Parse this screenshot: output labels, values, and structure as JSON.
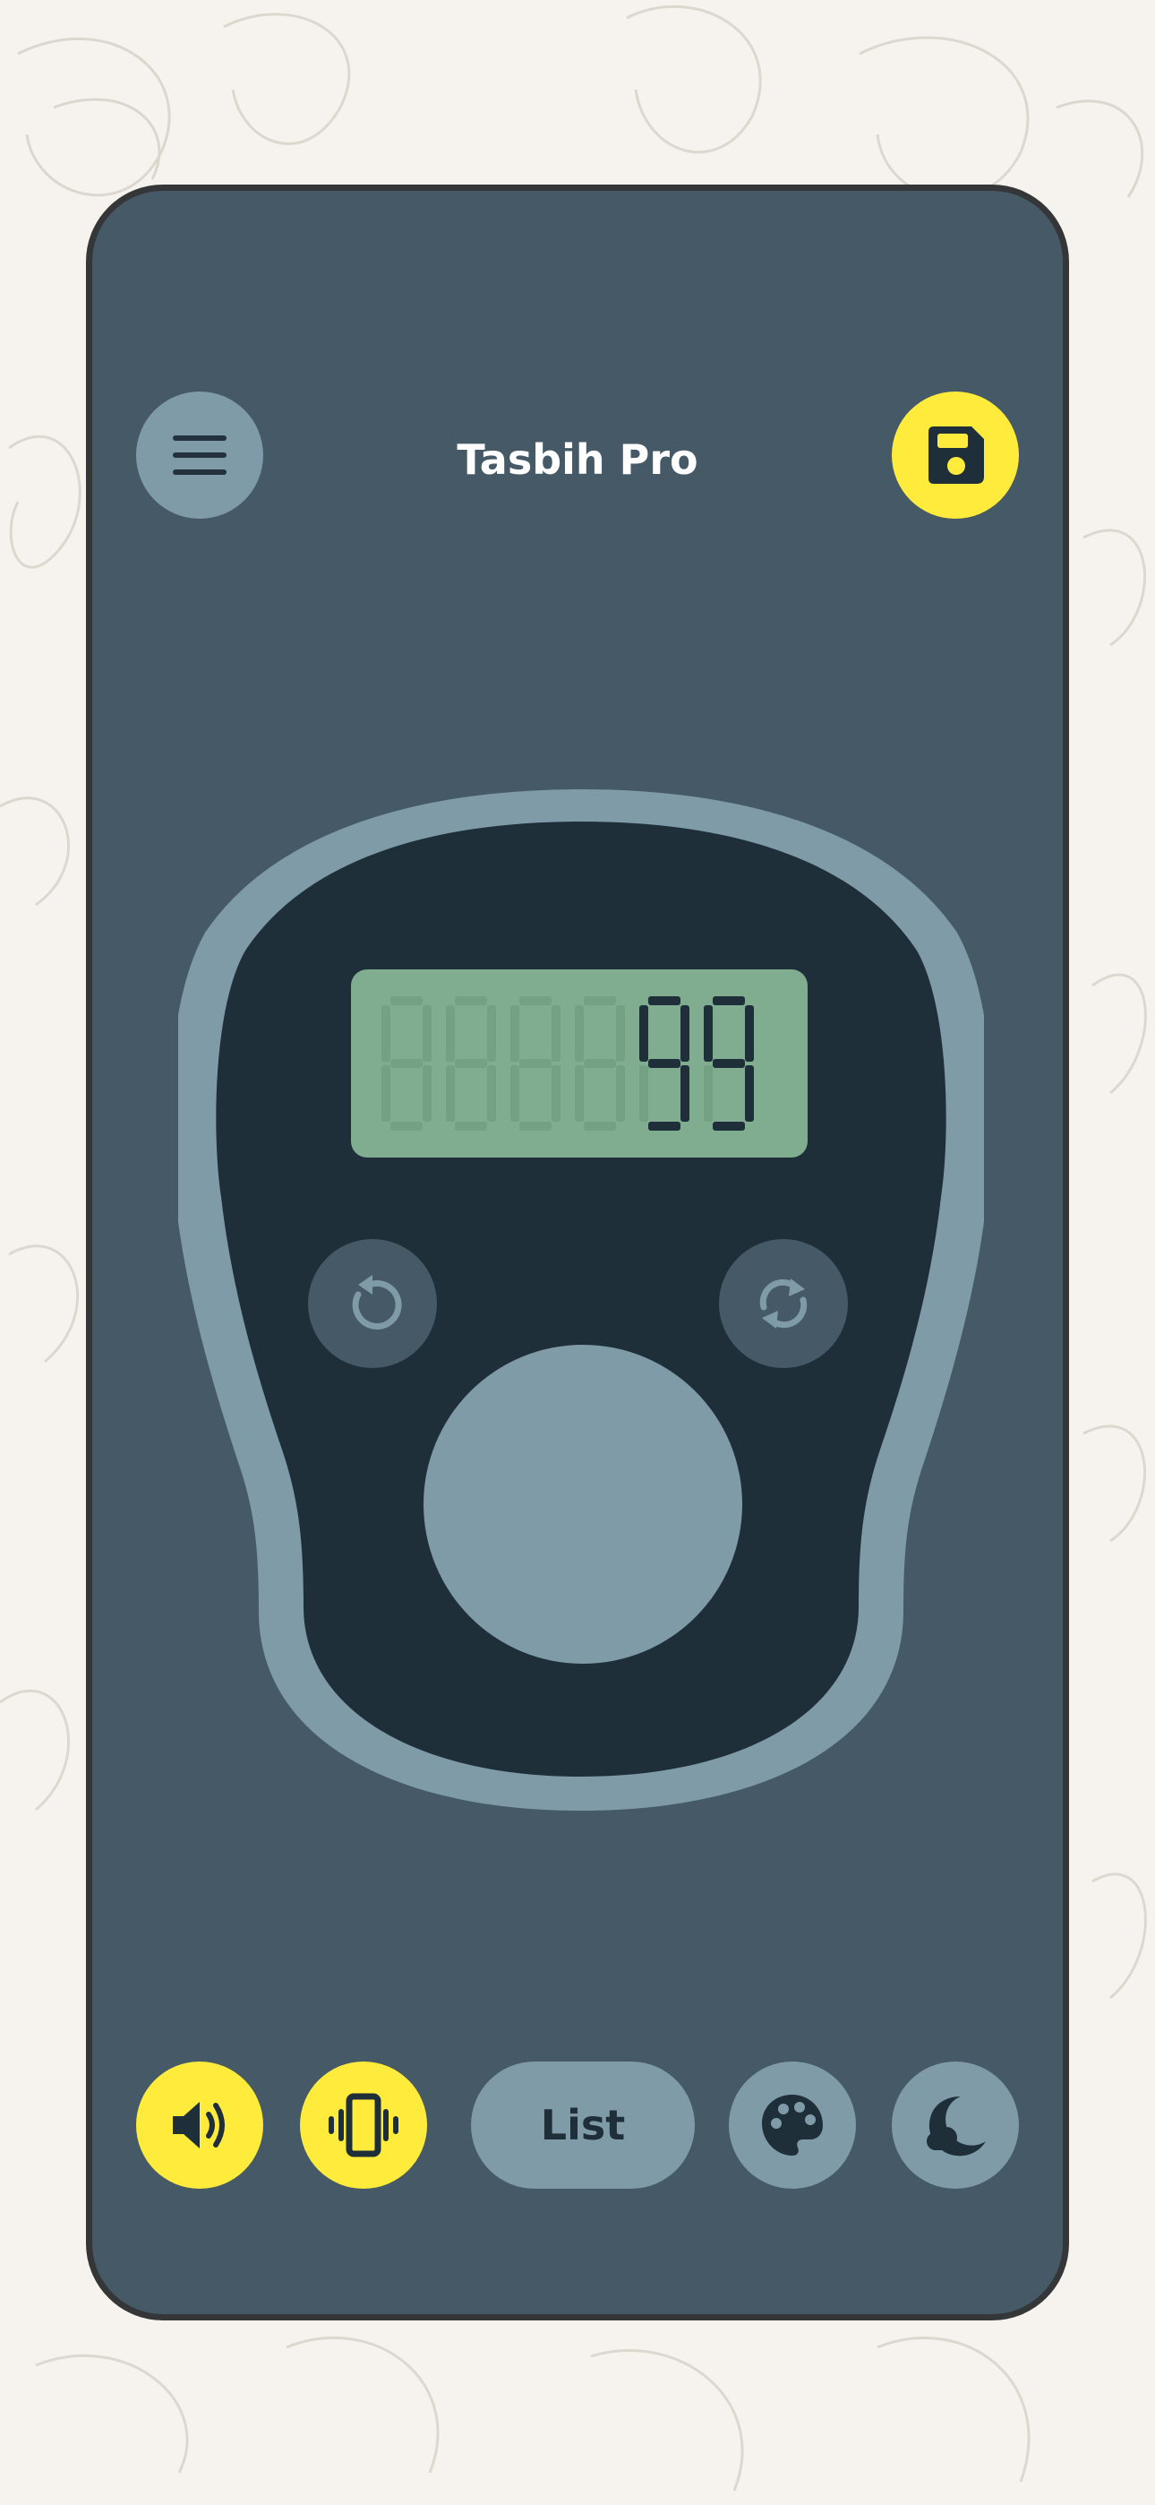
{
  "app": {
    "title": "Tasbih Pro"
  },
  "header": {
    "menu_icon": "hamburger-menu-icon",
    "save_icon": "floppy-disk-icon"
  },
  "counter": {
    "display_value": "99",
    "display_digits": 6,
    "undo_icon": "undo-arrow-icon",
    "reset_icon": "refresh-arrows-icon"
  },
  "toolbar": {
    "sound_icon": "speaker-volume-icon",
    "vibration_icon": "phone-vibration-icon",
    "list_label": "List",
    "theme_icon": "palette-icon",
    "night_mode_icon": "moon-cloud-icon"
  },
  "colors": {
    "page_background": "#f6f3ee",
    "phone_background": "#455a66",
    "counter_outline": "#7e9ba7",
    "counter_body": "#1e2f39",
    "lcd_background": "#80ad8f",
    "accent_yellow": "#ffeb3b",
    "muted_button": "#7e9ba7"
  }
}
